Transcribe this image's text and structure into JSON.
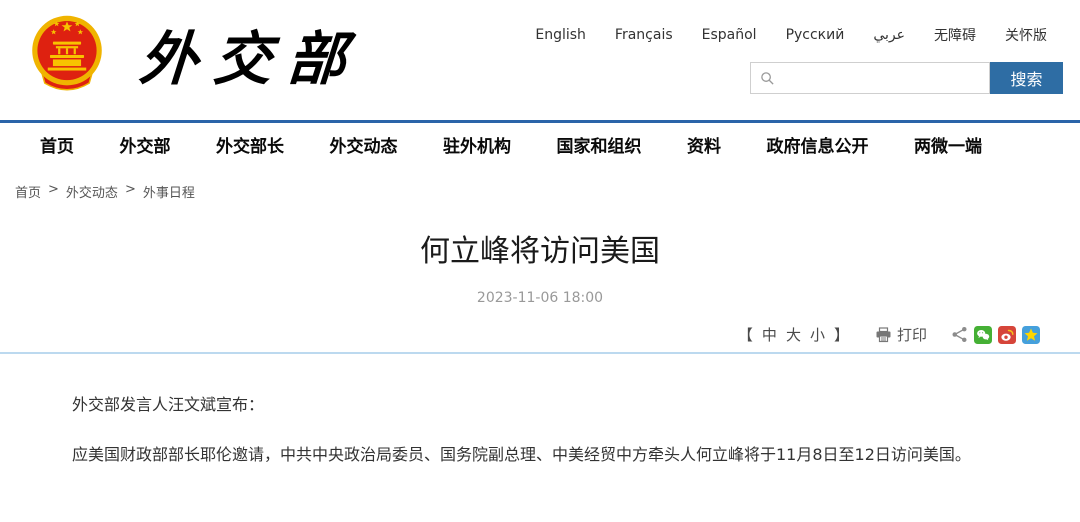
{
  "header": {
    "calligraphy_title": "外交部",
    "languages": [
      "English",
      "Français",
      "Español",
      "Русский",
      "عربي",
      "无障碍",
      "关怀版"
    ],
    "search": {
      "value": "",
      "button": "搜索"
    }
  },
  "nav": {
    "items": [
      "首页",
      "外交部",
      "外交部长",
      "外交动态",
      "驻外机构",
      "国家和组织",
      "资料",
      "政府信息公开",
      "两微一端"
    ]
  },
  "breadcrumb": {
    "separator": ">",
    "items": [
      "首页",
      "外交动态",
      "外事日程"
    ]
  },
  "article": {
    "title": "何立峰将访问美国",
    "datetime": "2023-11-06 18:00",
    "toolbar": {
      "bracket_open": "【",
      "font_medium": "中",
      "font_large": "大",
      "font_small": "小",
      "bracket_close": "】",
      "print": "打印"
    },
    "paragraphs": {
      "p1": "外交部发言人汪文斌宣布：",
      "p2": "应美国财政部部长耶伦邀请，中共中央政治局委员、国务院副总理、中美经贸中方牵头人何立峰将于11月8日至12日访问美国。"
    }
  },
  "colors": {
    "header_line": "#2a64a9",
    "search_button": "#2e6da4",
    "divider": "#bcd9ef",
    "emblem_red": "#de2110",
    "emblem_gold": "#f0b400",
    "wechat_green": "#45b035",
    "weibo_red": "#d6453a",
    "qzone_blue": "#45a0dc",
    "star_yellow": "#ffd500"
  }
}
